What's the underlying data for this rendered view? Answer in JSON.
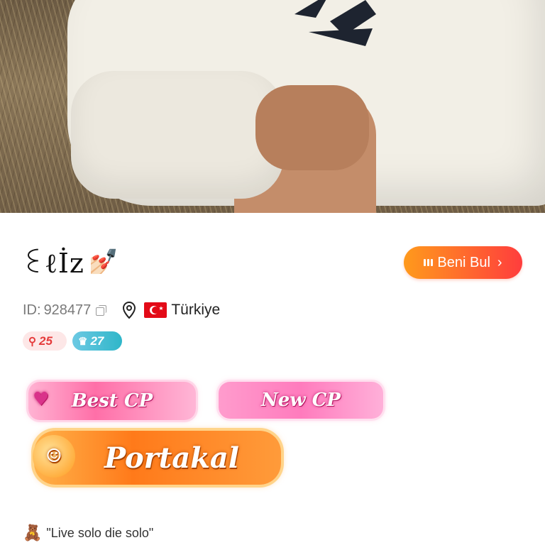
{
  "profile": {
    "name": "ꏂℓİz",
    "name_emoji": "💅🏻",
    "id_label": "ID:",
    "id_value": "928477",
    "country": "Türkiye"
  },
  "actions": {
    "find_me_label": "Beni Bul"
  },
  "badges": {
    "rich_level": "25",
    "user_level": "27"
  },
  "medals": {
    "best_cp": "Best CP",
    "new_cp": "New CP",
    "portakal": "Portakal"
  },
  "bio": {
    "motto": "\"Live solo die solo\""
  },
  "colors": {
    "find_me_gradient_start": "#ff9a1c",
    "find_me_gradient_end": "#ff3d3d",
    "rich_badge_text": "#e53a3a",
    "level_badge_bg": "#2fb6c9"
  },
  "icons": {
    "copy": "copy-icon",
    "location": "location-pin-icon",
    "flag": "turkey-flag-icon",
    "chevron": "chevron-right-icon"
  }
}
